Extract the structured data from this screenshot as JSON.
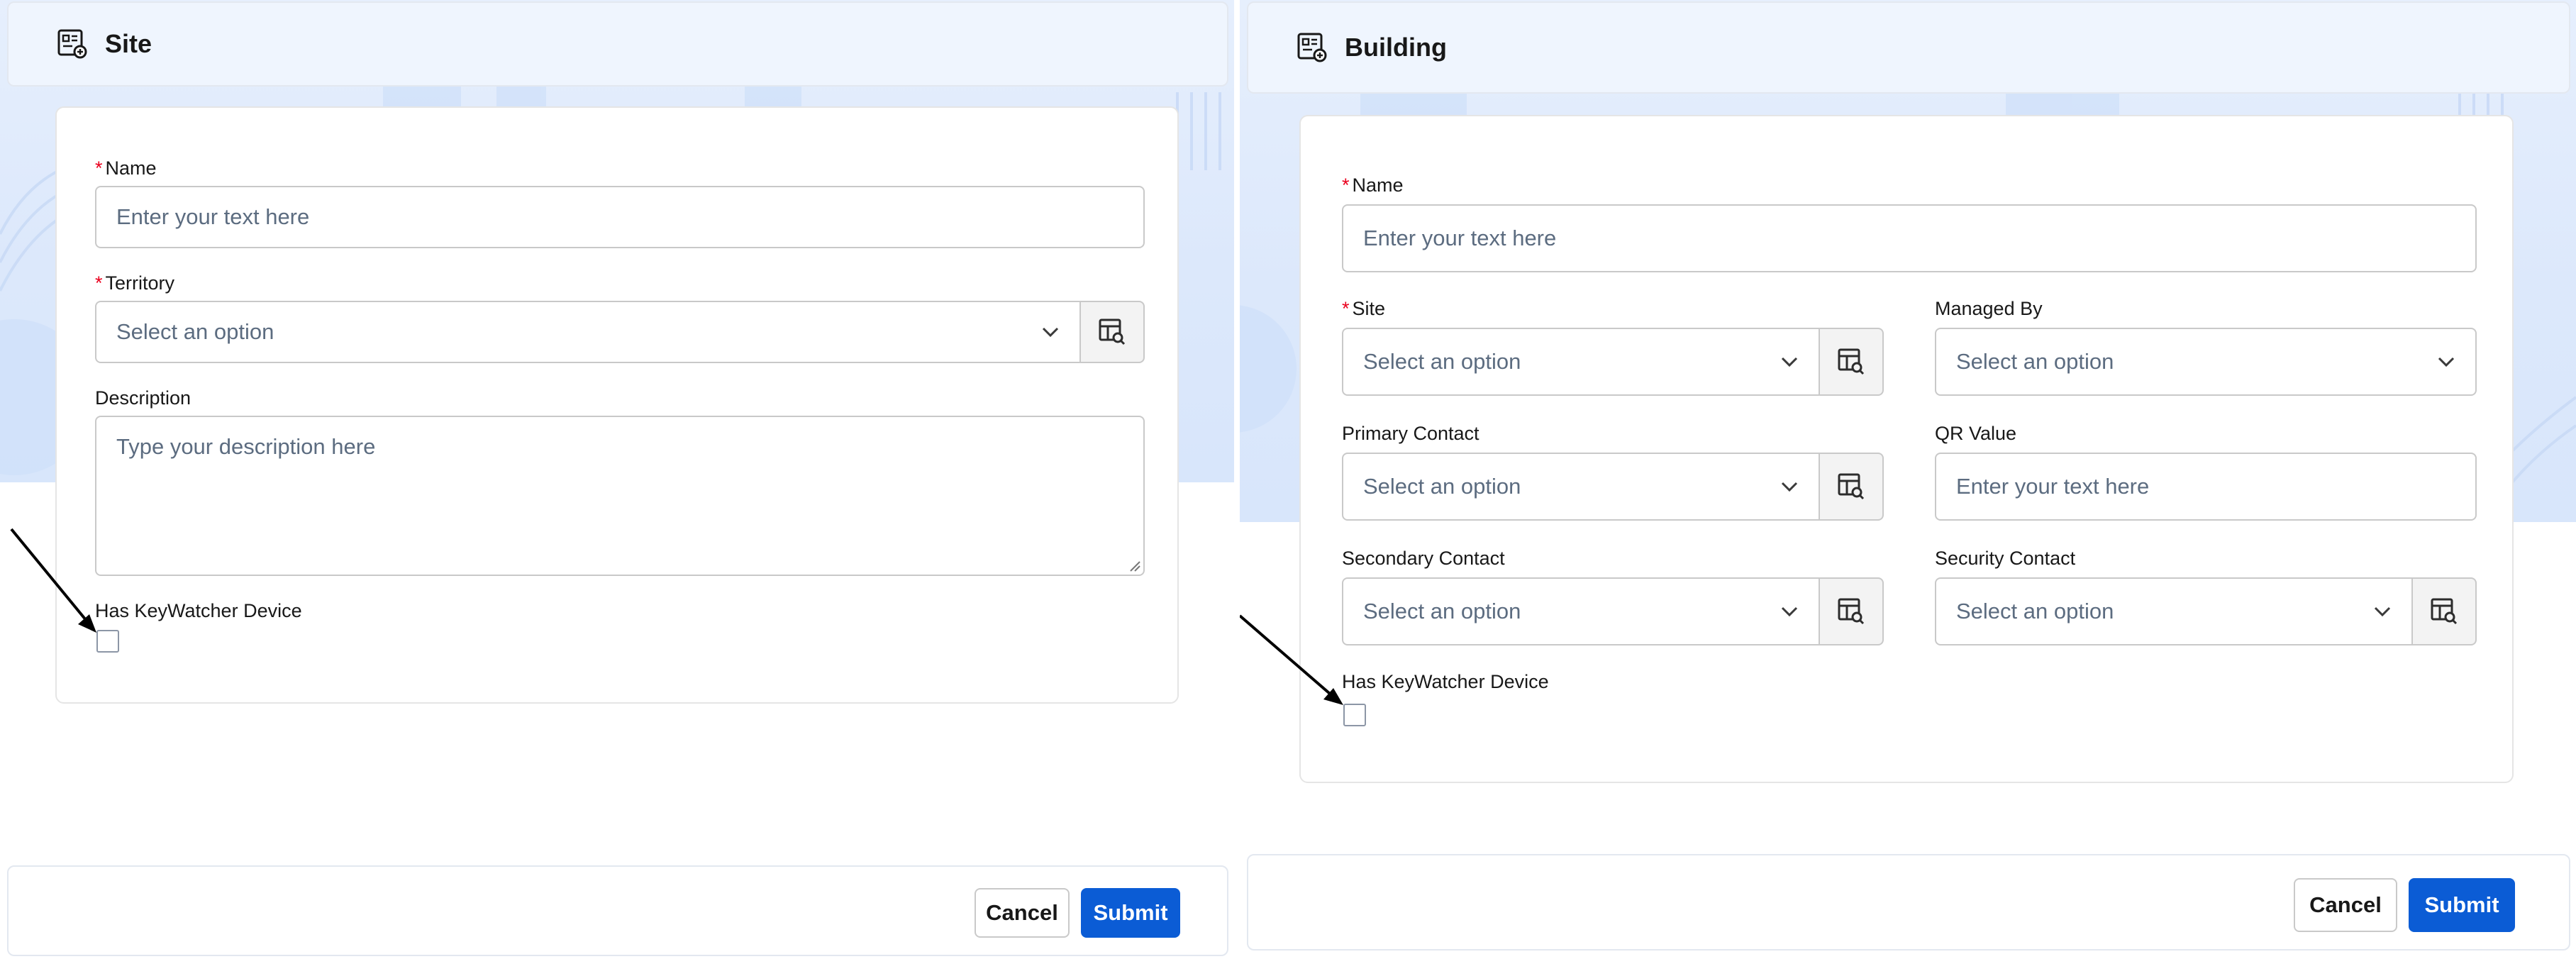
{
  "site_form": {
    "title": "Site",
    "fields": {
      "name": {
        "label": "Name",
        "required": true,
        "placeholder": "Enter your text here"
      },
      "territory": {
        "label": "Territory",
        "required": true,
        "placeholder": "Select an option"
      },
      "description": {
        "label": "Description",
        "placeholder": "Type your description here"
      },
      "keywatcher": {
        "label": "Has KeyWatcher Device",
        "checked": false
      }
    },
    "actions": {
      "cancel": "Cancel",
      "submit": "Submit"
    }
  },
  "building_form": {
    "title": "Building",
    "fields": {
      "name": {
        "label": "Name",
        "required": true,
        "placeholder": "Enter your text here"
      },
      "site": {
        "label": "Site",
        "required": true,
        "placeholder": "Select an option"
      },
      "managed_by": {
        "label": "Managed By",
        "placeholder": "Select an option"
      },
      "primary_contact": {
        "label": "Primary Contact",
        "placeholder": "Select an option"
      },
      "qr_value": {
        "label": "QR Value",
        "placeholder": "Enter your text here"
      },
      "secondary_contact": {
        "label": "Secondary Contact",
        "placeholder": "Select an option"
      },
      "security_contact": {
        "label": "Security Contact",
        "placeholder": "Select an option"
      },
      "keywatcher": {
        "label": "Has KeyWatcher Device",
        "checked": false
      }
    },
    "actions": {
      "cancel": "Cancel",
      "submit": "Submit"
    }
  },
  "icons": {
    "header": "record-form-icon",
    "lookup": "table-search-icon",
    "dropdown": "chevron-down-icon",
    "annotation": "arrow-pointer"
  },
  "colors": {
    "accent": "#0b5cd5",
    "required": "#ea001e",
    "background": "#dce8fb",
    "annotation": "#000000"
  }
}
